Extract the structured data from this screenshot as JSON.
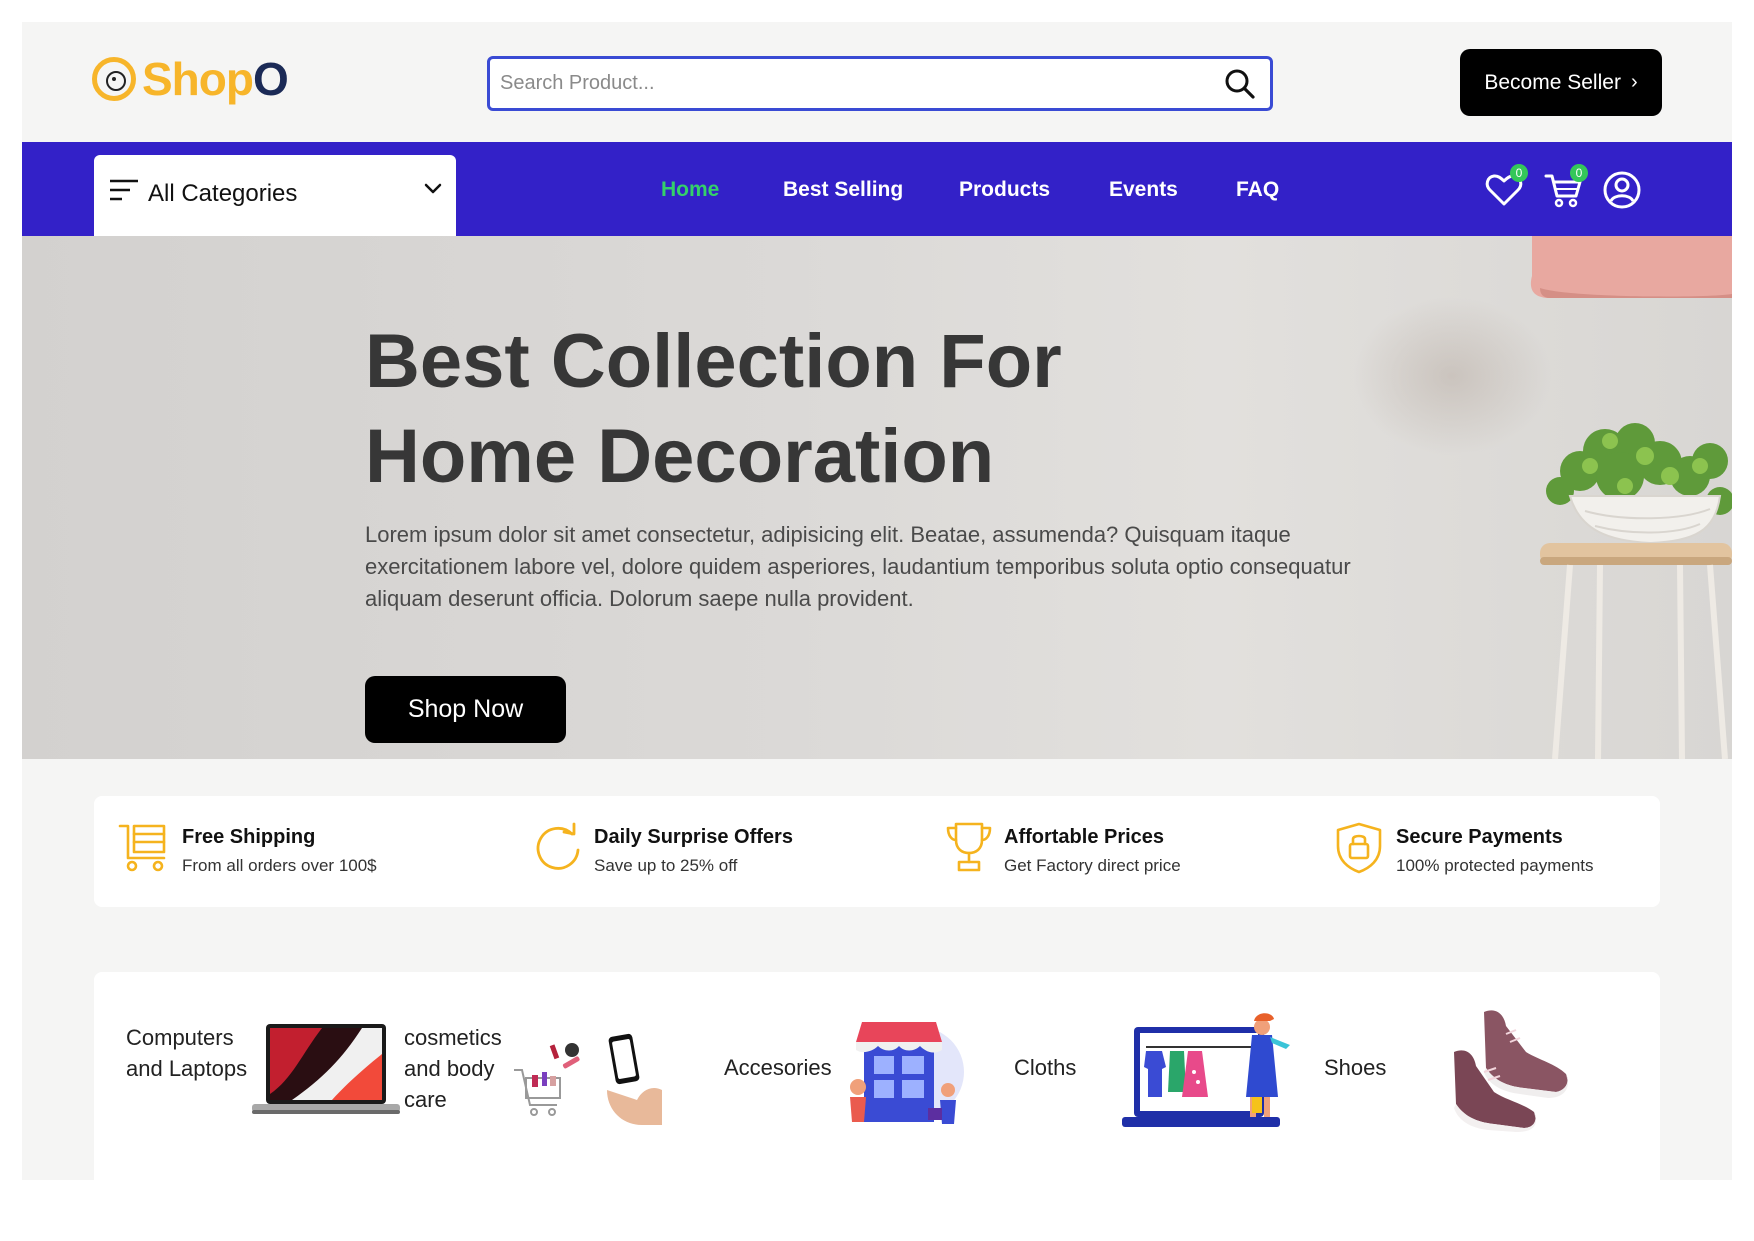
{
  "header": {
    "logo_text_main": "Shop",
    "logo_text_accent": "O",
    "search_placeholder": "Search Product...",
    "become_seller_label": "Become Seller",
    "become_seller_chevron": "›"
  },
  "nav": {
    "categories_label": "All Categories",
    "links": [
      {
        "label": "Home",
        "active": true
      },
      {
        "label": "Best Selling",
        "active": false
      },
      {
        "label": "Products",
        "active": false
      },
      {
        "label": "Events",
        "active": false
      },
      {
        "label": "FAQ",
        "active": false
      }
    ],
    "wishlist_count": "0",
    "cart_count": "0",
    "icons": [
      "heart-icon",
      "cart-icon",
      "user-profile-icon"
    ],
    "active_color": "#34d06a",
    "bar_color": "#3321c8"
  },
  "hero": {
    "title_line1": "Best Collection For",
    "title_line2": "Home Decoration",
    "description": "Lorem ipsum dolor sit amet consectetur, adipisicing elit. Beatae, assumenda? Quisquam itaque exercitationem labore vel, dolore quidem asperiores, laudantium temporibus soluta optio consequatur\naliquam deserunt officia. Dolorum saepe nulla provident.",
    "cta_label": "Shop Now"
  },
  "features": [
    {
      "title": "Free Shipping",
      "subtitle": "From all orders over 100$",
      "icon": "shipping-cart-icon"
    },
    {
      "title": "Daily Surprise Offers",
      "subtitle": "Save up to 25% off",
      "icon": "refresh-icon"
    },
    {
      "title": "Affortable Prices",
      "subtitle": "Get Factory direct price",
      "icon": "trophy-icon"
    },
    {
      "title": "Secure Payments",
      "subtitle": "100% protected payments",
      "icon": "lock-shield-icon"
    }
  ],
  "categories": [
    {
      "label": "Computers and Laptops",
      "image": "laptop-image"
    },
    {
      "label": "cosmetics and body care",
      "image": "cosmetics-image"
    },
    {
      "label": "Accesories",
      "image": "accessories-store-image"
    },
    {
      "label": "Cloths",
      "image": "cloths-laptop-image"
    },
    {
      "label": "Shoes",
      "image": "shoes-image"
    }
  ],
  "colors": {
    "brand_yellow": "#f7b52a",
    "brand_navy": "#1b2a56",
    "accent_blue": "#3a4bd4",
    "feature_icon": "#f5b31e"
  }
}
